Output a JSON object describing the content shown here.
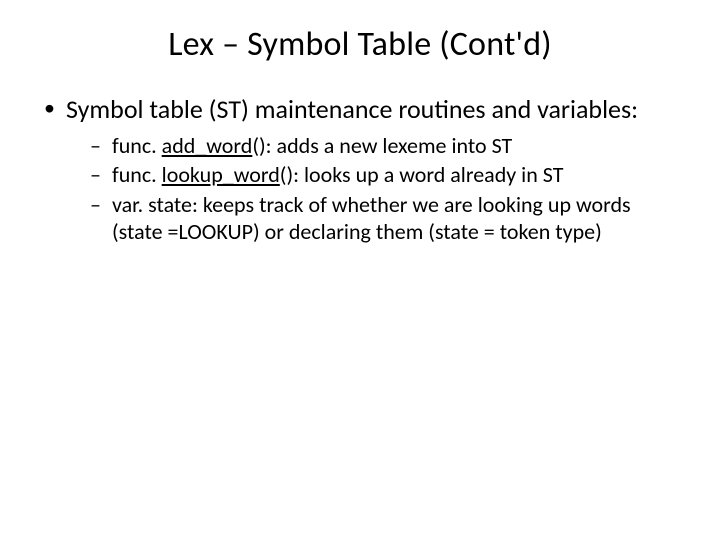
{
  "title": "Lex – Symbol Table (Cont'd)",
  "bullet1": "Symbol table (ST) maintenance  routines and variables:",
  "sub1_pre": "func. ",
  "sub1_u": "add_word",
  "sub1_post": "(): adds a new lexeme into ST",
  "sub2_pre": "func. ",
  "sub2_u": "lookup_word",
  "sub2_post": "(): looks up a word already in ST",
  "sub3": "var. state: keeps track of whether we are looking up words (state =LOOKUP) or declaring them (state = token type)"
}
